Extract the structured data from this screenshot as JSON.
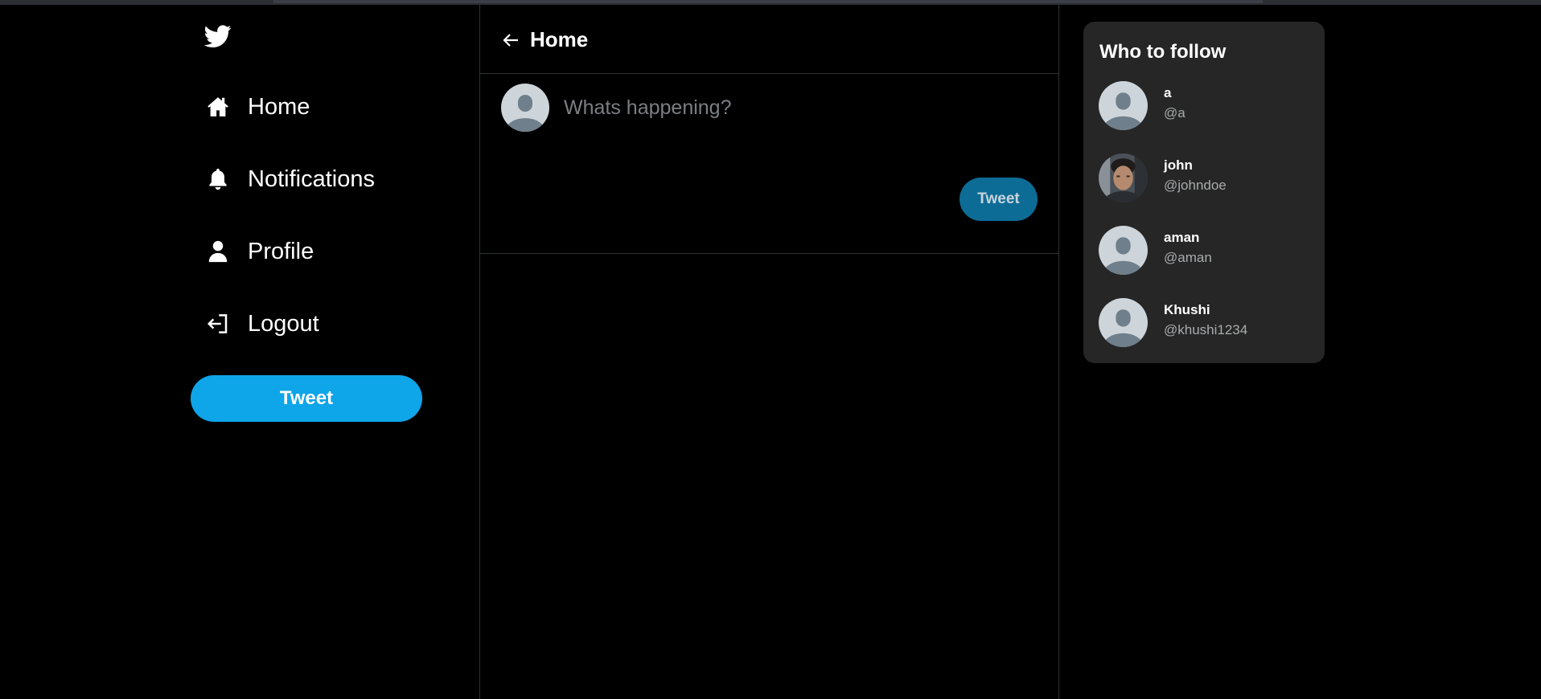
{
  "sidebar": {
    "logo_icon": "twitter-bird-icon",
    "nav": [
      {
        "label": "Home",
        "icon": "home-icon"
      },
      {
        "label": "Notifications",
        "icon": "bell-icon"
      },
      {
        "label": "Profile",
        "icon": "user-icon"
      },
      {
        "label": "Logout",
        "icon": "logout-icon"
      }
    ],
    "tweet_button_label": "Tweet"
  },
  "main": {
    "back_icon": "arrow-left-icon",
    "title": "Home",
    "composer": {
      "placeholder": "Whats happening?",
      "value": "",
      "tweet_button_label": "Tweet"
    }
  },
  "who_to_follow": {
    "title": "Who to follow",
    "users": [
      {
        "name": "a",
        "handle": "@a",
        "avatar": "default-avatar"
      },
      {
        "name": "john",
        "handle": "@johndoe",
        "avatar": "photo-avatar"
      },
      {
        "name": "aman",
        "handle": "@aman",
        "avatar": "default-avatar"
      },
      {
        "name": "Khushi",
        "handle": "@khushi1234",
        "avatar": "default-avatar"
      }
    ]
  },
  "colors": {
    "background": "#000000",
    "accent": "#0ea5e9",
    "accent_dim": "#0c6c96",
    "card": "#262626",
    "border": "#2f3336",
    "muted_text": "#a8aaac"
  }
}
